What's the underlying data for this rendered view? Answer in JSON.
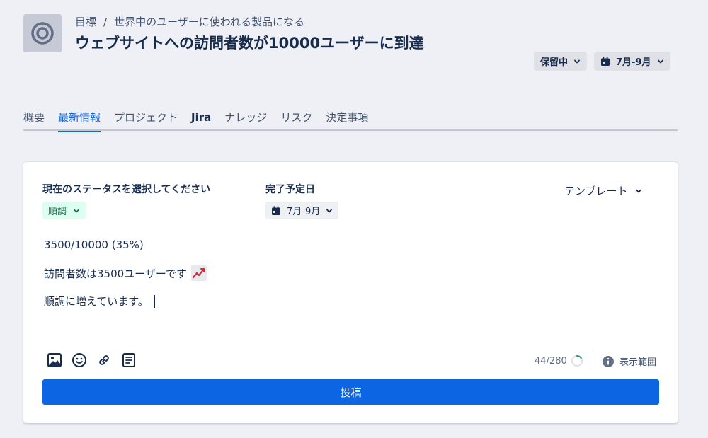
{
  "header": {
    "breadcrumb_root": "目標",
    "breadcrumb_separator": "/",
    "breadcrumb_parent": "世界中のユーザーに使われる製品になる",
    "title": "ウェブサイトへの訪問者数が10000ユーザーに到達",
    "status_label": "保留中",
    "date_label": "7月-9月"
  },
  "tabs": [
    {
      "label": "概要"
    },
    {
      "label": "最新情報"
    },
    {
      "label": "プロジェクト"
    },
    {
      "label": "Jira"
    },
    {
      "label": "ナレッジ"
    },
    {
      "label": "リスク"
    },
    {
      "label": "決定事項"
    }
  ],
  "active_tab": "最新情報",
  "update_form": {
    "status_heading": "現在のステータスを選択してください",
    "status_value": "順調",
    "due_heading": "完了予定日",
    "due_value": "7月-9月",
    "template_label": "テンプレート",
    "lines": [
      "3500/10000 (35%)",
      "訪問者数は3500ユーザーです",
      "順調に増えています。"
    ],
    "emoji": "chart-increasing-icon",
    "char_count": "44/280",
    "char_progress": 0.157,
    "visibility_label": "表示範囲",
    "post_label": "投稿"
  },
  "colors": {
    "accent": "#0c66e4",
    "on_track_bg": "#dcfff1",
    "on_track_text": "#216e4e",
    "page_bg": "#eef0f5"
  }
}
